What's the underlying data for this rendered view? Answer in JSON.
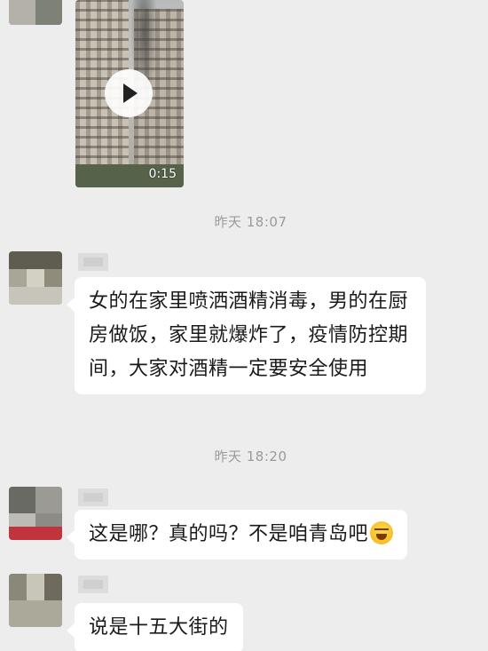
{
  "messages": {
    "video": {
      "duration": "0:15",
      "play_icon": "play-icon"
    },
    "timestamp_1": "昨天 18:07",
    "text_1": "女的在家里喷洒酒精消毒，男的在厨房做饭，家里就爆炸了，疫情防控期间，大家对酒精一定要安全使用",
    "timestamp_2": "昨天 18:20",
    "text_2": "这是哪？真的吗？不是咱青岛吧",
    "text_2_emoji": "laughing-crying-emoji",
    "text_3": "说是十五大街的"
  },
  "colors": {
    "background": "#ededed",
    "bubble": "#ffffff",
    "timestamp_text": "#9a9a9a",
    "message_text": "#1a1a1a"
  }
}
